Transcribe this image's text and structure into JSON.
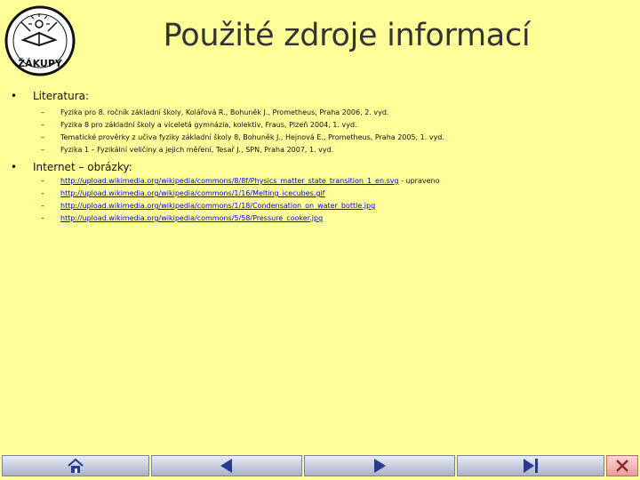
{
  "title": "Použité zdroje informací",
  "logo_text": "ŽÁKUPY",
  "sections": [
    {
      "bullet": "•",
      "heading": "Literatura:",
      "items": [
        "Fyzika pro 8. ročník základní školy, Kolářová R., Bohuněk J., Prometheus, Praha 2006, 2. vyd.",
        "Fyzika 8 pro základní školy a víceletá gymnázia, kolektiv, Fraus, Plzeň 2004, 1. vyd.",
        "Tematické prověrky z učiva fyziky základní školy 8, Bohuněk J., Hejnová E., Prometheus, Praha 2005, 1. vyd.",
        "Fyzika 1 – Fyzikální veličiny a jejich měření, Tesař J., SPN, Praha 2007, 1. vyd."
      ]
    },
    {
      "bullet": "•",
      "heading": "Internet – obrázky:",
      "links": [
        {
          "url": "http://upload.wikimedia.org/wikipedia/commons/8/8f/Physics_matter_state_transition_1_en.svg",
          "suffix": " - upraveno"
        },
        {
          "url": "http://upload.wikimedia.org/wikipedia/commons/1/16/Melting_icecubes.gif",
          "suffix": ""
        },
        {
          "url": "http://upload.wikimedia.org/wikipedia/commons/1/18/Condensation_on_water_bottle.jpg",
          "suffix": ""
        },
        {
          "url": "http://upload.wikimedia.org/wikipedia/commons/5/58/Pressure_cooker.jpg",
          "suffix": ""
        }
      ]
    }
  ],
  "dash": "–",
  "nav": {
    "home_icon": "home-icon",
    "prev_icon": "triangle-left-icon",
    "next_icon": "triangle-right-icon",
    "last_icon": "skip-end-icon",
    "close_icon": "close-icon",
    "colors": {
      "button": "#C5CAE0",
      "close": "#F2B3B3",
      "accent": "#2B3A8C"
    }
  }
}
